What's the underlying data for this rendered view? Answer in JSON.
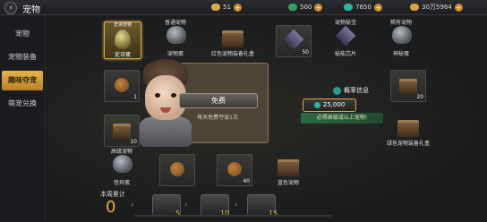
{
  "header": {
    "back_icon": "chevron-left-icon",
    "title": "宠物",
    "resources": [
      {
        "icon": "coin-icon",
        "value": "51",
        "color": "#d8a84a"
      },
      {
        "icon": "green-crystal-icon",
        "value": "500",
        "color": "#35a05e"
      },
      {
        "icon": "gem-icon",
        "value": "7650",
        "color": "#2bb5a0"
      },
      {
        "icon": "gold-icon",
        "value": "30万5964",
        "color": "#d6a23e"
      }
    ]
  },
  "sidebar": {
    "items": [
      {
        "label": "宠物",
        "active": false
      },
      {
        "label": "宠物装备",
        "active": false
      },
      {
        "label": "趣味夺宠",
        "active": true
      },
      {
        "label": "萌宠兑换",
        "active": false
      }
    ]
  },
  "grid": {
    "top_row": [
      {
        "top": "普通宠物",
        "name": "宠物蛋"
      },
      {
        "top": "",
        "name": "红色宠物装备礼盒"
      },
      {
        "top": "宠物秘宝",
        "name": "秘能芯片"
      },
      {
        "top": "稀有宠物",
        "name": "神秘蛋"
      }
    ],
    "featured": {
      "top": "史诗宠物",
      "name": "史诗蛋"
    },
    "top_cell_count": "50",
    "left_cells": [
      {
        "count": "1"
      },
      {
        "count": "10"
      }
    ],
    "right_cells": [
      {
        "count": "20"
      },
      {
        "count": ""
      }
    ],
    "right_label": "绿色宠物装备礼盒",
    "bottom_row": [
      {
        "top": "高级宠物",
        "name": "怪异蛋"
      },
      {
        "count": ""
      },
      {
        "count": "40"
      },
      {
        "name": "蓝色宠物"
      }
    ]
  },
  "center": {
    "free_label": "免费",
    "free_sub": "每天免费夺宠1次"
  },
  "probability": {
    "label": "概率信息",
    "cost": "25,000",
    "strip_text": "必得高级或以上宠物!"
  },
  "weekly": {
    "label": "本周累计",
    "value": "0",
    "progress": 0,
    "milestones": [
      "5",
      "10",
      "15"
    ]
  }
}
